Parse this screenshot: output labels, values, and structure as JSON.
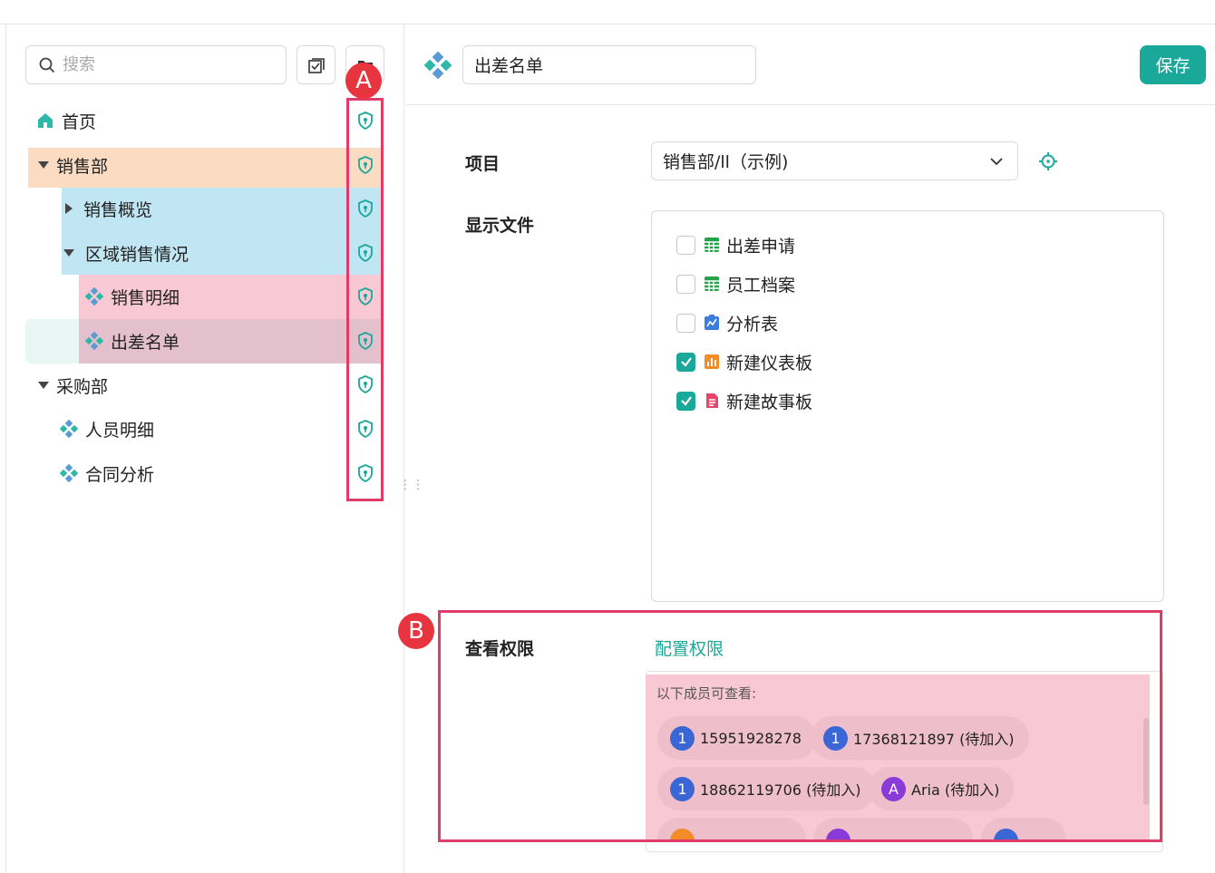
{
  "sidebar": {
    "search_placeholder": "搜索",
    "items": [
      {
        "label": "首页"
      },
      {
        "label": "销售部"
      },
      {
        "label": "销售概览"
      },
      {
        "label": "区域销售情况"
      },
      {
        "label": "销售明细"
      },
      {
        "label": "出差名单"
      },
      {
        "label": "采购部"
      },
      {
        "label": "人员明细"
      },
      {
        "label": "合同分析"
      }
    ]
  },
  "annotations": {
    "a": "A",
    "b": "B"
  },
  "header": {
    "title_value": "出差名单",
    "save_label": "保存"
  },
  "form": {
    "project_label": "项目",
    "project_value": "销售部/ll（示例)",
    "files_label": "显示文件",
    "files": [
      {
        "label": "出差申请",
        "checked": false
      },
      {
        "label": "员工档案",
        "checked": false
      },
      {
        "label": "分析表",
        "checked": false
      },
      {
        "label": "新建仪表板",
        "checked": true
      },
      {
        "label": "新建故事板",
        "checked": true
      }
    ],
    "permission_label": "查看权限",
    "config_link": "配置权限",
    "members_title": "以下成员可查看:",
    "members": [
      {
        "avatar": "1",
        "name": "15951928278"
      },
      {
        "avatar": "1",
        "name": "17368121897 (待加入)"
      },
      {
        "avatar": "1",
        "name": "18862119706 (待加入)"
      },
      {
        "avatar": "A",
        "name": "Aria (待加入)"
      }
    ]
  },
  "colors": {
    "accent": "#1aa89a",
    "annotation": "#e03c6a",
    "highlight_orange": "#fbdcc3",
    "highlight_blue": "#c1e6f3",
    "highlight_pink": "#f8c8d5",
    "selected_pink": "#e4c0cc"
  }
}
